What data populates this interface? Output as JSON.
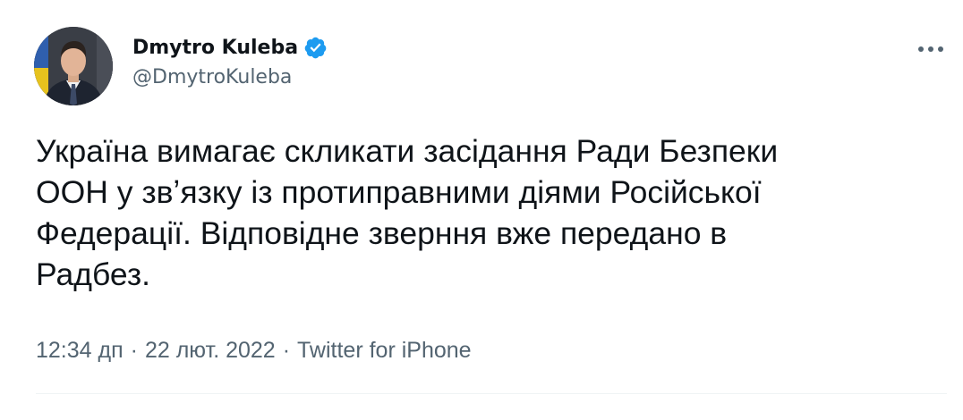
{
  "author": {
    "display_name": "Dmytro Kuleba",
    "handle": "@DmytroKuleba",
    "verified": true,
    "verified_color": "#1d9bf0"
  },
  "icons": {
    "avatar": "profile-photo",
    "verified": "verified-badge-icon",
    "more": "more-options-icon"
  },
  "tweet": {
    "text": "Україна вимагає скликати засідання Ради Безпеки\nООН у звʼязку із протиправними діями Російської\nФедерації. Відповідне зверння вже передано в\nРадбез.",
    "time": "12:34 дп",
    "date": "22 лют. 2022",
    "source": "Twitter for iPhone",
    "separator": "·"
  },
  "colors": {
    "text": "#0f1419",
    "secondary": "#536471",
    "divider": "#eff3f4"
  }
}
